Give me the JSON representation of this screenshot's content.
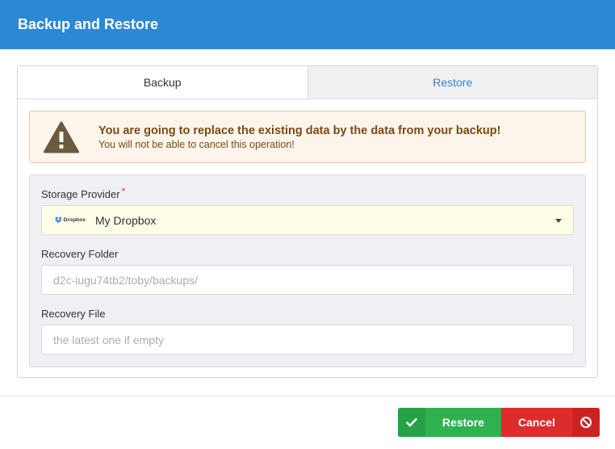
{
  "dialog": {
    "title": "Backup and Restore"
  },
  "tabs": [
    {
      "label": "Backup",
      "active": true
    },
    {
      "label": "Restore",
      "active": false
    }
  ],
  "warning": {
    "title": "You are going to replace the existing data by the data from your backup!",
    "subtitle": "You will not be able to cancel this operation!",
    "icon": "warning-triangle-icon"
  },
  "form": {
    "storage_provider": {
      "label": "Storage Provider",
      "required_mark": "*",
      "value": "My Dropbox",
      "logo_text": "Dropbox",
      "icon": "dropbox-icon"
    },
    "recovery_folder": {
      "label": "Recovery Folder",
      "placeholder": "d2c-iugu74tb2/toby/backups/"
    },
    "recovery_file": {
      "label": "Recovery File",
      "placeholder": "the latest one if empty"
    }
  },
  "footer": {
    "restore_label": "Restore",
    "cancel_label": "Cancel",
    "restore_icon": "check-icon",
    "cancel_icon": "ban-icon"
  },
  "colors": {
    "accent": "#2d88d4",
    "restore": "#2fb150",
    "cancel": "#de2b2b",
    "warning_bg": "#fdf5ec",
    "warning_text": "#7a4a14"
  }
}
